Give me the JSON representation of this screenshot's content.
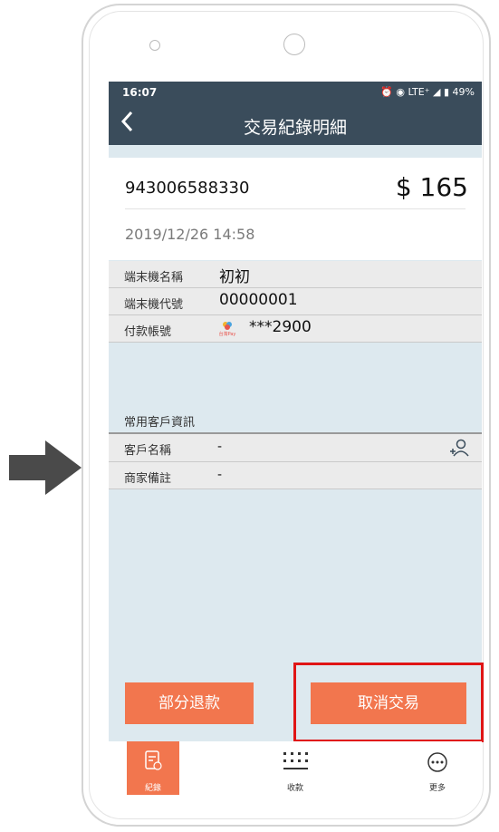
{
  "status_bar": {
    "time": "16:07",
    "icons": "⏰ ◉ LTE⁺ ◢ ▮ 49%"
  },
  "header": {
    "back_icon": "chevron-left-icon",
    "title": "交易紀錄明細"
  },
  "transaction": {
    "id": "943006588330",
    "amount": "$ 165",
    "datetime": "2019/12/26 14:58"
  },
  "details": [
    {
      "label": "端末機名稱",
      "value": "初初"
    },
    {
      "label": "端末機代號",
      "value": "00000001"
    },
    {
      "label": "付款帳號",
      "value": "***2900",
      "logo_text": "台灣Pay"
    }
  ],
  "customer_section": {
    "title": "常用客戶資訊",
    "rows": [
      {
        "label": "客戶名稱",
        "value": "-"
      },
      {
        "label": "商家備註",
        "value": "-"
      }
    ]
  },
  "buttons": {
    "partial_refund": "部分退款",
    "cancel_transaction": "取消交易"
  },
  "bottom_nav": [
    {
      "label": "紀錄",
      "icon": "receipt-icon",
      "active": true
    },
    {
      "label": "收款",
      "icon": "scan-icon",
      "active": false
    },
    {
      "label": "更多",
      "icon": "more-icon",
      "active": false
    }
  ],
  "colors": {
    "header_bg": "#3a4c5b",
    "accent": "#f2764e",
    "highlight": "#e01515",
    "screen_bg": "#dde9ef"
  }
}
